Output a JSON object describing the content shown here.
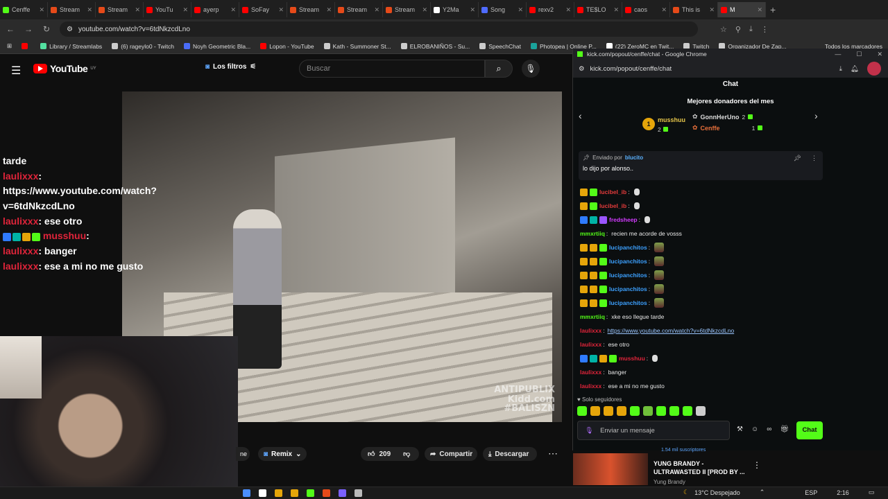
{
  "browser": {
    "tabs": [
      {
        "label": "Cenffe",
        "color": "#53fc18"
      },
      {
        "label": "Stream",
        "color": "#e64a19"
      },
      {
        "label": "Stream",
        "color": "#e64a19"
      },
      {
        "label": "YouTu",
        "color": "#ff0000"
      },
      {
        "label": "ayerp",
        "color": "#ff0000"
      },
      {
        "label": "SoFay",
        "color": "#ff0000"
      },
      {
        "label": "Stream",
        "color": "#e64a19"
      },
      {
        "label": "Stream",
        "color": "#e64a19"
      },
      {
        "label": "Stream",
        "color": "#e64a19"
      },
      {
        "label": "Y2Ma",
        "color": "#ffffff"
      },
      {
        "label": "Song",
        "color": "#4f6bff"
      },
      {
        "label": "rexv2",
        "color": "#ff0000"
      },
      {
        "label": "TE$LO",
        "color": "#ff0000"
      },
      {
        "label": "caos",
        "color": "#ff0000"
      },
      {
        "label": "This is",
        "color": "#e64a19"
      },
      {
        "label": "M",
        "color": "#ff0000"
      }
    ],
    "url": "youtube.com/watch?v=6tdNkzcdLno",
    "bookmarks": [
      {
        "label": "",
        "color": "#ff0000"
      },
      {
        "label": "Library / Streamlabs",
        "color": "#53e0a0"
      },
      {
        "label": "(6) rageylo0 - Twitch",
        "color": "#cccccc"
      },
      {
        "label": "Noyh Geometric Bla...",
        "color": "#4a6cf7"
      },
      {
        "label": "Lopon - YouTube",
        "color": "#ff0000"
      },
      {
        "label": "Kath - Summoner St...",
        "color": "#cccccc"
      },
      {
        "label": "ELROBANIÑOS - Su...",
        "color": "#cccccc"
      },
      {
        "label": "SpeechChat",
        "color": "#cccccc"
      },
      {
        "label": "Photopea | Online P...",
        "color": "#1aa39b"
      },
      {
        "label": "(22) ZeroMC en Twit...",
        "color": "#ffffff"
      },
      {
        "label": "Twitch",
        "color": "#cccccc"
      },
      {
        "label": "Organizador De Zap...",
        "color": "#cccccc"
      }
    ],
    "all_bookmarks": "Todos los marcadores"
  },
  "youtube": {
    "logo": "YouTube",
    "logo_sup": "UY",
    "filters_label": "Los filtros",
    "search_placeholder": "Buscar",
    "watermark": "ANTIPUBLIX\nKidd.com\n#BALISZN",
    "remix_label": "Remix",
    "like_count": "209",
    "share_label": "Compartir",
    "download_label": "Descargar",
    "partial_tab": "ne"
  },
  "overlay_chat": [
    {
      "user": "",
      "text": "tarde"
    },
    {
      "user": "laulixxx",
      "text": ": https://www.youtube.com/watch?v=6tdNkzcdLno"
    },
    {
      "user": "laulixxx",
      "text": ": ese otro"
    },
    {
      "user": "musshuu",
      "text": ":",
      "badges": true
    },
    {
      "user": "laulixxx",
      "text": ": banger"
    },
    {
      "user": "laulixxx",
      "text": ": ese a mi no me gusto"
    }
  ],
  "popup": {
    "window_title": "kick.com/popout/cenffe/chat - Google Chrome",
    "url": "kick.com/popout/cenffe/chat",
    "chat_title": "Chat",
    "donors_title": "Mejores donadores del mes",
    "donors": [
      {
        "rank": "1",
        "name": "musshuu",
        "value": "2"
      },
      {
        "name": "GonnHerUno",
        "value": "2"
      },
      {
        "name": "Cenffe",
        "value": "1"
      }
    ],
    "pinned": {
      "prefix": "Enviado por",
      "by": "blucito",
      "message": "lo dijo por alonso.."
    },
    "messages": [
      {
        "user": "lucibel_ib",
        "color": "#e43b3b",
        "text": "",
        "emote": "w",
        "badges": [
          "#e5a50a",
          "#53fc18"
        ]
      },
      {
        "user": "lucibel_ib",
        "color": "#e43b3b",
        "text": "",
        "emote": "w",
        "badges": [
          "#e5a50a",
          "#53fc18"
        ]
      },
      {
        "user": "fredsheep",
        "color": "#d23bff",
        "text": "",
        "emote": "w",
        "badges": [
          "#2f7bff",
          "#00b3a6",
          "#9a55ff"
        ]
      },
      {
        "user": "mmxrtiiq",
        "color": "#53fc18",
        "text": "recien me acorde de vosss",
        "emote": "",
        "badges": []
      },
      {
        "user": "lucipanchitos",
        "color": "#3ca0ff",
        "text": "",
        "emote": "e",
        "badges": [
          "#e5a50a",
          "#e5a50a",
          "#53fc18"
        ]
      },
      {
        "user": "lucipanchitos",
        "color": "#3ca0ff",
        "text": "",
        "emote": "e",
        "badges": [
          "#e5a50a",
          "#e5a50a",
          "#53fc18"
        ]
      },
      {
        "user": "lucipanchitos",
        "color": "#3ca0ff",
        "text": "",
        "emote": "e",
        "badges": [
          "#e5a50a",
          "#e5a50a",
          "#53fc18"
        ]
      },
      {
        "user": "lucipanchitos",
        "color": "#3ca0ff",
        "text": "",
        "emote": "e",
        "badges": [
          "#e5a50a",
          "#e5a50a",
          "#53fc18"
        ]
      },
      {
        "user": "lucipanchitos",
        "color": "#3ca0ff",
        "text": "",
        "emote": "e",
        "badges": [
          "#e5a50a",
          "#e5a50a",
          "#53fc18"
        ]
      },
      {
        "user": "mmxrtiiq",
        "color": "#53fc18",
        "text": "xke eso llegue tarde",
        "emote": "",
        "badges": []
      },
      {
        "user": "laulixxx",
        "color": "#e0243a",
        "text": "",
        "link": "https://www.youtube.com/watch?v=6tdNkzcdLno",
        "emote": "",
        "badges": []
      },
      {
        "user": "laulixxx",
        "color": "#e0243a",
        "text": "ese otro",
        "emote": "",
        "badges": []
      },
      {
        "user": "musshuu",
        "color": "#e0243a",
        "text": "",
        "emote": "w",
        "badges": [
          "#2f7bff",
          "#00b3a6",
          "#e5a50a",
          "#53fc18"
        ]
      },
      {
        "user": "laulixxx",
        "color": "#e0243a",
        "text": "banger",
        "emote": "",
        "badges": []
      },
      {
        "user": "laulixxx",
        "color": "#e0243a",
        "text": "ese a mi no me gusto",
        "emote": "",
        "badges": []
      }
    ],
    "followers_only": "Solo seguidores",
    "emote_colors": [
      "#53fc18",
      "#e5a50a",
      "#e5a50a",
      "#e5a50a",
      "#53fc18",
      "#6fbf3a",
      "#53fc18",
      "#53fc18",
      "#53fc18",
      "#cccccc"
    ],
    "message_placeholder": "Enviar un mensaje",
    "chat_button": "Chat"
  },
  "suggested": {
    "subs": "1.54 mil suscriptores",
    "title": "YUNG BRANDY - ULTRAWASTED II [PROD BY ...",
    "channel": "Yung Brandy"
  },
  "taskbar": {
    "icon_colors": [
      "#4a8fff",
      "#ffffff",
      "#e5a50a",
      "#e5a50a",
      "#53fc18",
      "#e64a19",
      "#7b61ff",
      "#bbbbbb"
    ],
    "weather": "13°C  Despejado",
    "language": "ESP",
    "time": "2:16"
  }
}
